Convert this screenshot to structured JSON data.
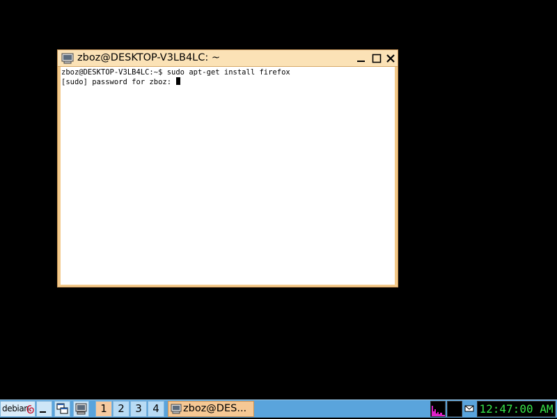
{
  "window": {
    "title": "zboz@DESKTOP-V3LB4LC: ~",
    "icon": "terminal-icon",
    "buttons": {
      "minimize": "minimize-icon",
      "maximize": "maximize-icon",
      "close": "close-icon"
    }
  },
  "terminal": {
    "lines": [
      "zboz@DESKTOP-V3LB4LC:~$ sudo apt-get install firefox",
      "[sudo] password for zboz: "
    ],
    "cursor": "block-cursor"
  },
  "taskbar": {
    "start_label": "debian",
    "start_icon": "debian-swirl-icon",
    "launchers": [
      "show-desktop-icon",
      "window-list-icon",
      "terminal-icon"
    ],
    "desktops": [
      "1",
      "2",
      "3",
      "4"
    ],
    "active_desktop": "1",
    "task_label": "zboz@DES...",
    "tray": [
      "cpu-monitor-icon",
      "network-monitor-icon",
      "mail-icon"
    ],
    "clock": "12:47:00 AM"
  },
  "colors": {
    "desktop_bg": "#000000",
    "window_frame": "#f3c98a",
    "titlebar": "#fbe2b6",
    "taskbar": "#5aa4dc",
    "clock_text": "#39e649",
    "cpu_graph": "#e020c8"
  }
}
